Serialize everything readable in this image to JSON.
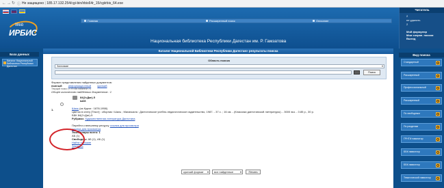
{
  "browser": {
    "lock_label": "Не защищено",
    "url": "185.17.132.254/cgi-bin/irbis64r_15/cgiirbis_64.exe"
  },
  "header": {
    "logo_web": "Web",
    "logo_irbis": "ИРБИС",
    "library_title": "Национальная библиотека Республики Дагестан им. Р. Гамзатова",
    "links": [
      "Главная",
      "Расширенный поиск",
      "Описание"
    ]
  },
  "reader": {
    "title": "Читатель",
    "lines": [
      "2",
      "не удалить",
      "2",
      "Мой формуляр",
      "Мои сохран. поиски",
      "Выход"
    ]
  },
  "left_sidebar": {
    "title": "База данных",
    "item": "Каталог Национальной библиотеки Республики Дагестан"
  },
  "main": {
    "catalog_title": "Каталог Национальной Библиотеки Республики Дагестан» результаты поиска",
    "search_panel_title": "Область поиска",
    "field_value": "Заглавие",
    "query_value": "",
    "search_button": "Поиск",
    "format_label": "Формат представления найденных документов:",
    "format_options": [
      "полный",
      "информационный",
      "краткий"
    ],
    "extra_line": "Текущий поиск: (<.>I=ЗАГЛАВИЕ$<.>)",
    "total_found": "Общее количество найденных документов : 1",
    "record": {
      "number": "1.",
      "shelf1": "84(2=Даг)-5",
      "shelf2": "Ш28",
      "author_link": "Шахь",
      "author_rest": "(из Курхи : 1878-1958)",
      "title_line": "Цветок в снегу [Текст] : сборник / Шахь ; Махачкала : Дагестанское учебно-педагогическое издательство, 1987. - 37 с. ; 16 см. - (Классики дагестанской литературы). - 3000 экз. - 0.85 р., 30 р.",
      "bbk": "ББК 84(2=Даг)-5",
      "rubric_prefix": "Рубрики:",
      "rubric_link": "Художественная литература Дагестана",
      "transfer_text": "Перейти к внешнему ресурсу",
      "transfer_link": "ссылка для просмотра",
      "view_link": "ссылка для просмотра",
      "copies_label": "Экземпляры всего: 1",
      "copies_location": "АБ (1)",
      "free_label": "Свободны:",
      "free_value": "АБ (1), АБ (1)",
      "find_similar": "Найти похожие",
      "order_link": "Заказать"
    },
    "bottom": {
      "format_select": "краткий формат",
      "scope_select": "все найденные",
      "print_button": "Печать"
    }
  },
  "right_sidebar": {
    "title": "Вид поиска",
    "items": [
      "Стандартный",
      "Расширенный",
      "Профессиональный",
      "Расширенный",
      "По свободным",
      "По разделам",
      "ГРНТИ навигатор",
      "ББК навигатор",
      "ББК навигатор",
      "Тематический навигатор"
    ]
  },
  "colors": {
    "background": "#0d4f8b",
    "accent": "#f3b233",
    "highlight": "#d3242a"
  }
}
